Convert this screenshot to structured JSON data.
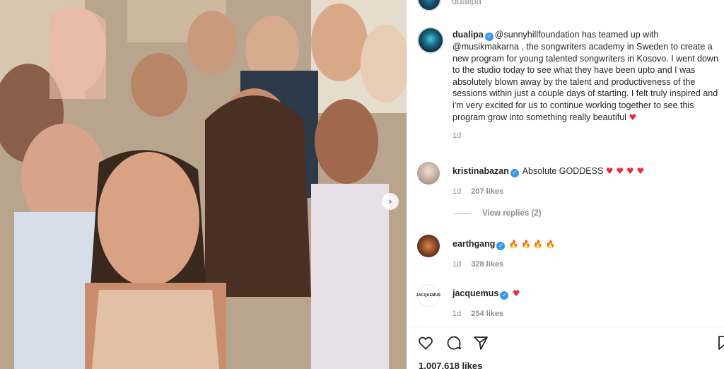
{
  "post": {
    "top_username": "dualipa",
    "next_icon": "chevron-right-icon",
    "caption": {
      "username": "dualipa",
      "mention1": "@sunnyhillfoundation",
      "text1": " has teamed up with ",
      "mention2": "@musikmakarna",
      "text2": " , the songwriters academy in Sweden to create a new program for young talented songwriters in Kosovo. I went down to the studio today to see what they have been upto and I was absolutely blown away by the talent and productiveness of the sessions within just a couple days of starting. I felt truly inspired and i'm very excited for us to continue working together to see this program grow into something really beautiful ",
      "emoji": "♥",
      "time": "1d"
    },
    "comments": [
      {
        "username": "kristinabazan",
        "text": "Absolute GODDESS ",
        "emoji": "♥ ♥ ♥ ♥",
        "time": "1d",
        "likes": "207 likes",
        "replies": "View replies (2)"
      },
      {
        "username": "earthgang",
        "text": "",
        "emoji": "🔥 🔥 🔥 🔥",
        "time": "1d",
        "likes": "328 likes"
      },
      {
        "username": "jacquemus",
        "text": "",
        "emoji": "♥",
        "time": "1d",
        "likes": "254 likes",
        "avatar_text": "JACQUEMUS"
      }
    ],
    "likes_count": "1,007,618 likes",
    "colors": {
      "heart": "#ed2c3b",
      "verified": "#3897f0",
      "secondary_text": "#8e8e8e"
    }
  }
}
